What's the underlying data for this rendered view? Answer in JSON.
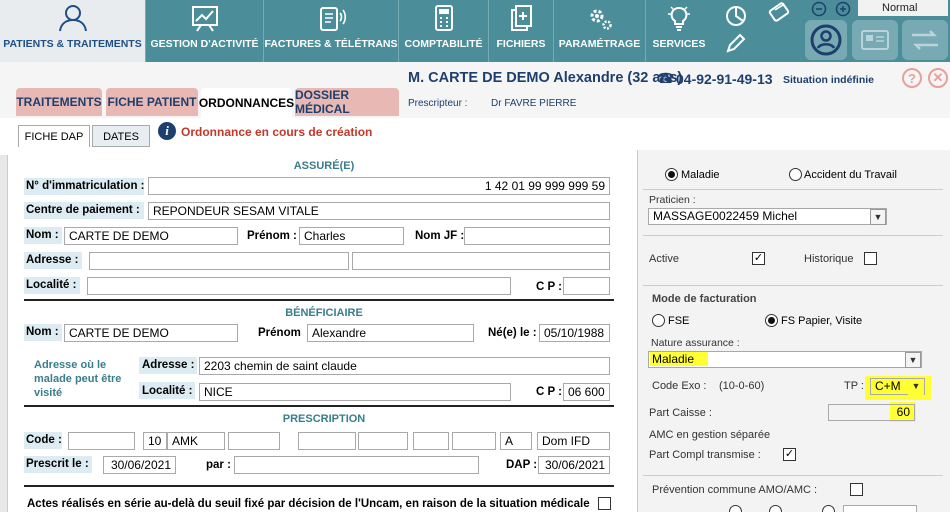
{
  "nav": {
    "items": [
      {
        "label": "PATIENTS & TRAITEMENTS",
        "icon": "patients-icon"
      },
      {
        "label": "GESTION D'ACTIVITÉ",
        "icon": "activity-chart-icon"
      },
      {
        "label": "FACTURES & TÉLÉTRANS",
        "icon": "invoice-transmit-icon"
      },
      {
        "label": "COMPTABILITÉ",
        "icon": "calculator-icon"
      },
      {
        "label": "FICHIERS",
        "icon": "files-icon"
      },
      {
        "label": "PARAMÉTRAGE",
        "icon": "settings-gears-icon"
      },
      {
        "label": "SERVICES",
        "icon": "lightbulb-icon"
      }
    ],
    "mode_select": "Normal"
  },
  "patient": {
    "name": "M. CARTE DE DEMO Alexandre (32 ans)",
    "phone": "04-92-91-49-13",
    "situation": "Situation indéfinie",
    "prescriber_label": "Prescripteur :",
    "prescriber": "Dr FAVRE PIERRE"
  },
  "tabs": [
    "TRAITEMENTS",
    "FICHE PATIENT",
    "ORDONNANCES",
    "DOSSIER MÉDICAL"
  ],
  "subtabs": [
    "FICHE DAP",
    "DATES"
  ],
  "status_message": "Ordonnance en cours de création",
  "assure": {
    "title": "ASSURÉ(E)",
    "immat_label": "N° d'immatriculation :",
    "immat": "1 42 01 99 999 999 59",
    "centre_label": "Centre de paiement :",
    "centre": "REPONDEUR SESAM VITALE",
    "nom_label": "Nom :",
    "nom": "CARTE DE DEMO",
    "prenom_label": "Prénom :",
    "prenom": "Charles",
    "nomjf_label": "Nom JF :",
    "nomjf": "",
    "adresse_label": "Adresse :",
    "adresse1": "",
    "adresse2": "",
    "localite_label": "Localité :",
    "localite": "",
    "cp_label": "C P :",
    "cp": ""
  },
  "beneficiaire": {
    "title": "BÉNÉFICIAIRE",
    "nom_label": "Nom :",
    "nom": "CARTE DE DEMO",
    "prenom_label": "Prénom",
    "prenom": "Alexandre",
    "ne_label": "Né(e) le :",
    "ne": "05/10/1988",
    "adresse_malade_label": "Adresse où le malade peut être visité",
    "adresse_label": "Adresse :",
    "adresse": "2203 chemin de saint claude",
    "localite_label": "Localité :",
    "localite": "NICE",
    "cp_label": "C P :",
    "cp": "06 600"
  },
  "prescription": {
    "title": "PRESCRIPTION",
    "code_label": "Code :",
    "code_fields": [
      "",
      "10",
      "AMK",
      "",
      "",
      "",
      "",
      "",
      "A",
      "Dom IFD"
    ],
    "prescrit_label": "Prescrit le :",
    "prescrit": "30/06/2021",
    "par_label": "par :",
    "par": "",
    "dap_label": "DAP :",
    "dap": "30/06/2021"
  },
  "serie_text": "Actes réalisés en série au-delà du seuil fixé par décision de l'Uncam, en raison de la situation médicale",
  "right": {
    "maladie": "Maladie",
    "accident": "Accident du Travail",
    "praticien_label": "Praticien :",
    "praticien": "MASSAGE0022459 Michel",
    "active_label": "Active",
    "active_checked": true,
    "historique_label": "Historique",
    "historique_checked": false,
    "mode_fact_label": "Mode de facturation",
    "fse": "FSE",
    "fs_papier": "FS Papier, Visite",
    "nature_label": "Nature assurance :",
    "nature": "Maladie",
    "code_exo_label": "Code Exo :",
    "code_exo_range": "(10-0-60)",
    "tp_label": "TP :",
    "tp": "C+M",
    "part_caisse_label": "Part Caisse :",
    "part_caisse": "60",
    "amc_label": "AMC en gestion séparée",
    "part_compl_label": "Part Compl transmise :",
    "part_compl_checked": true,
    "prevention_label": "Prévention commune AMO/AMC :"
  },
  "colors": {
    "nav": "#4b8e99",
    "tab": "#e8b8b4",
    "accent": "#1e4f87",
    "highlight": "#ffff33",
    "error": "#c0392b"
  }
}
